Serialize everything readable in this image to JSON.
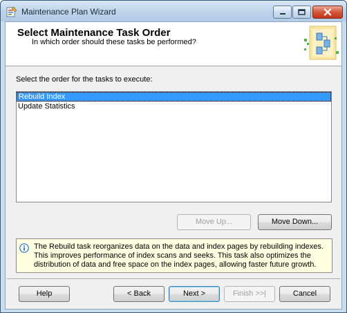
{
  "window": {
    "title": "Maintenance Plan Wizard"
  },
  "header": {
    "title": "Select Maintenance Task Order",
    "subtitle": "In which order should these tasks be performed?"
  },
  "main": {
    "prompt": "Select the order for the tasks to execute:",
    "tasks": [
      {
        "label": "Rebuild Index",
        "selected": true
      },
      {
        "label": "Update Statistics",
        "selected": false
      }
    ],
    "move_up_label": "Move Up...",
    "move_down_label": "Move Down...",
    "info_text": "The Rebuild task reorganizes data on the data and index pages by rebuilding indexes. This improves performance of index scans and seeks. This task also optimizes the distribution of data and free space on the index pages, allowing faster future growth."
  },
  "footer": {
    "help_label": "Help",
    "back_label": "< Back",
    "next_label": "Next >",
    "finish_label": "Finish >>|",
    "cancel_label": "Cancel"
  },
  "colors": {
    "selection": "#3399ff",
    "info_background": "#ffffe1",
    "title_bar": "#c9dced",
    "close_button": "#c2361b"
  }
}
